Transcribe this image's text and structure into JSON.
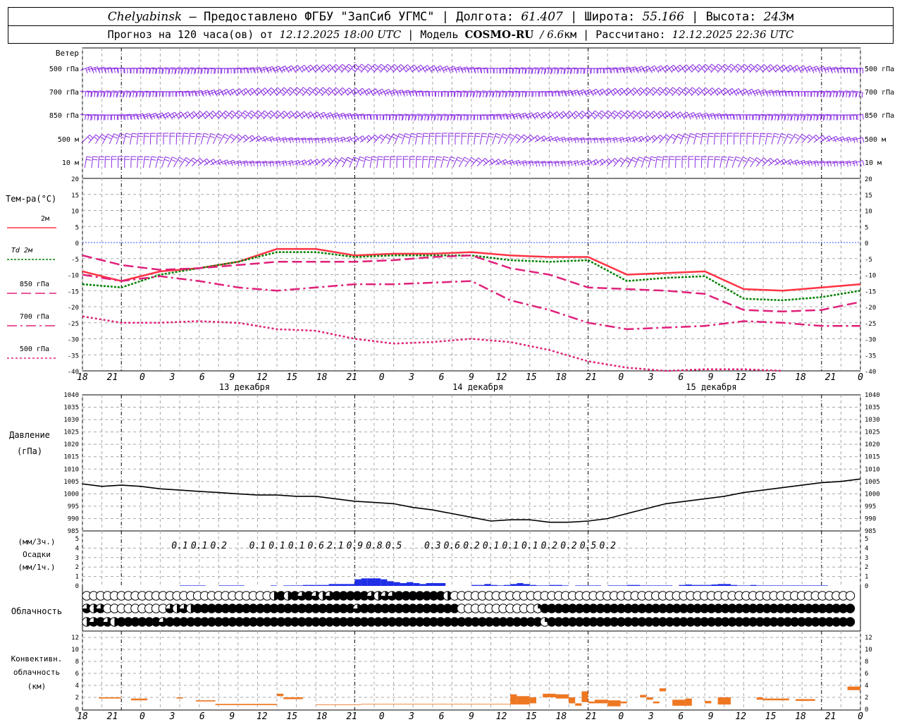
{
  "header": {
    "location": "Chelyabinsk",
    "provider": "— Предоставлено ФГБУ \"ЗапСиб УГМС\"",
    "lon_label": "Долгота:",
    "lon_value": "61.407",
    "lat_label": "Широта:",
    "lat_value": "55.166",
    "alt_label": "Высота:",
    "alt_value": "243",
    "alt_unit": "м",
    "forecast_label": "Прогноз на 120 часа(ов) от",
    "forecast_time": "12.12.2025 18:00 UTC",
    "model_label": "Модель",
    "model_name": "COSMO-RU",
    "model_res": "/ 6.6",
    "model_res_unit": "км",
    "calc_label": "Рассчитано:",
    "calc_time": "12.12.2025 22:36 UTC"
  },
  "colors": {
    "wind": "#8a2be2",
    "t2m": "#ff3344",
    "td2m": "#008000",
    "t850": "#e0207a",
    "t700": "#e0207a",
    "t500": "#e0207a",
    "zero_line": "#3355ff",
    "pressure": "#000000",
    "precip": "#1f2fe6",
    "convective": "#ee7722",
    "grid": "#a8a8a8"
  },
  "wind_panel": {
    "title": "Ветер",
    "levels": [
      "500 гПа",
      "700 гПа",
      "850 гПа",
      "500 м",
      "10  м"
    ]
  },
  "chart_data": [
    {
      "type": "line",
      "title": "Тем-ра(°C)",
      "ylim": [
        -40,
        20
      ],
      "yticks": [
        20,
        15,
        10,
        5,
        0,
        -5,
        -10,
        -15,
        -20,
        -25,
        -30,
        -35,
        -40
      ],
      "x_hours_from_start": [
        0,
        6,
        12,
        18,
        24,
        30,
        36,
        42,
        48,
        54,
        60,
        66,
        72,
        78,
        84,
        90,
        96,
        102,
        108,
        114,
        120
      ],
      "series": [
        {
          "name": "2м",
          "values": [
            -9,
            -12,
            -9,
            -8,
            -6,
            -2,
            -2,
            -4,
            -3.5,
            -3.5,
            -3,
            -4,
            -4.5,
            -4.5,
            -10,
            -9.5,
            -9,
            -14.5,
            -15,
            -14,
            -13
          ]
        },
        {
          "name": "Td 2м",
          "values": [
            -13,
            -14,
            -10,
            -8,
            -6,
            -3,
            -3,
            -4.5,
            -4,
            -4,
            -4,
            -5.5,
            -6,
            -5.5,
            -12,
            -11,
            -10.5,
            -17.5,
            -18,
            -17,
            -15
          ]
        },
        {
          "name": "850 гПа",
          "values": [
            -4,
            -7,
            -8.5,
            -8,
            -7,
            -6,
            -6,
            -6,
            -5.5,
            -4.5,
            -4,
            -8,
            -10,
            -14,
            -14.5,
            -15,
            -16,
            -21,
            -21.5,
            -21,
            -18.5
          ]
        },
        {
          "name": "700 гПа",
          "values": [
            -10,
            -12,
            -10.5,
            -12,
            -14,
            -15,
            -14,
            -13,
            -13,
            -12.5,
            -12,
            -18,
            -21,
            -25,
            -27,
            -26.5,
            -26,
            -24.5,
            -25,
            -26,
            -26
          ]
        },
        {
          "name": "500 гПа",
          "values": [
            -23,
            -25,
            -25,
            -24.5,
            -25,
            -27,
            -27.5,
            -30,
            -31.5,
            -31,
            -30,
            -31,
            -33.5,
            -37,
            -39,
            -40,
            -39.5,
            -39.5,
            -40
          ]
        }
      ],
      "x_ticks": [
        "18",
        "21",
        "0",
        "3",
        "6",
        "9",
        "12",
        "15",
        "18",
        "21",
        "0",
        "3",
        "6",
        "9",
        "12",
        "15",
        "18",
        "21",
        "0",
        "3",
        "6",
        "9",
        "12",
        "15",
        "18",
        "21",
        "0"
      ],
      "day_labels": [
        "13 декабря",
        "14 декабря",
        "15 декабря"
      ]
    },
    {
      "type": "line",
      "title": "Давление",
      "ylabel": "(гПа)",
      "ylim": [
        985,
        1040
      ],
      "yticks": [
        1040,
        1035,
        1030,
        1025,
        1020,
        1015,
        1010,
        1005,
        1000,
        995,
        990,
        985
      ],
      "x_hours_from_start": [
        0,
        3,
        6,
        9,
        12,
        15,
        18,
        21,
        24,
        27,
        30,
        33,
        36,
        39,
        42,
        45,
        48,
        51,
        54,
        57,
        60,
        63,
        66,
        69,
        72,
        75,
        78,
        81,
        84,
        87,
        90,
        93,
        96,
        99,
        102,
        105,
        108,
        111,
        114,
        117,
        120
      ],
      "series": [
        {
          "name": "",
          "values": [
            1004,
            1003,
            1003.5,
            1003,
            1002,
            1001.5,
            1001,
            1000.5,
            1000,
            999.5,
            999.5,
            999,
            999,
            998,
            997,
            996.5,
            996,
            994.5,
            993.5,
            992,
            990.5,
            989,
            989.5,
            989.5,
            988.5,
            988.5,
            989,
            990,
            992,
            994,
            996,
            997,
            998,
            999,
            1000.5,
            1001.5,
            1002.5,
            1003.5,
            1004.5,
            1005,
            1006
          ]
        }
      ]
    },
    {
      "type": "bar",
      "title": "Осадки",
      "ylabel_top": "(мм/3ч.)",
      "ylabel_bottom": "(мм/1ч.)",
      "ylim": [
        0,
        5
      ],
      "yticks": [
        5,
        4,
        3,
        2,
        1,
        0
      ],
      "interval_totals": [
        "0.1",
        "0.1",
        "0.2",
        "0.1",
        "0.1",
        "0.1",
        "0.6",
        "2.1",
        "0.9",
        "0.8",
        "0.5",
        "0.3",
        "0.6",
        "0.2",
        "0.1",
        "0.1",
        "0.1",
        "0.2",
        "0.2",
        "0.5",
        "0.2"
      ],
      "hourly_values": [
        0,
        0,
        0,
        0,
        0,
        0,
        0,
        0,
        0,
        0,
        0,
        0,
        0,
        0,
        0,
        0.05,
        0.05,
        0.05,
        0.05,
        0,
        0,
        0.05,
        0.05,
        0.05,
        0.05,
        0,
        0,
        0,
        0,
        0.05,
        0,
        0.05,
        0.05,
        0.05,
        0.1,
        0.1,
        0.1,
        0.1,
        0.2,
        0.2,
        0.2,
        0.2,
        0.7,
        0.8,
        0.8,
        0.8,
        0.7,
        0.5,
        0.4,
        0.3,
        0.4,
        0.3,
        0.2,
        0.3,
        0.3,
        0.3,
        0,
        0,
        0,
        0,
        0.1,
        0.1,
        0.2,
        0.1,
        0.05,
        0.1,
        0.2,
        0.3,
        0.2,
        0.1,
        0.05,
        0.05,
        0.1,
        0.1,
        0.05,
        0,
        0.05,
        0.05,
        0.05,
        0.05,
        0,
        0.05,
        0.05,
        0.05,
        0.1,
        0.1,
        0.05,
        0.05,
        0.05,
        0.05,
        0.05,
        0,
        0.1,
        0.15,
        0.1,
        0.1,
        0.1,
        0.15,
        0.2,
        0.2,
        0.1,
        0.05,
        0.05,
        0.1,
        0.05,
        0.05,
        0.05,
        0.05,
        0.05,
        0.05,
        0.05,
        0.05,
        0.05,
        0.05,
        0.05
      ]
    },
    {
      "type": "table",
      "title": "Облачность",
      "rows": 3,
      "note": "cloud cover fraction per hour, rows: high/medium/low",
      "values": [
        [
          0,
          0,
          0,
          0,
          0,
          0,
          0,
          0,
          0,
          0,
          0,
          0,
          0,
          0,
          0,
          0,
          0,
          0,
          0,
          0,
          0,
          0,
          0,
          0,
          0,
          0,
          0,
          0.5,
          1,
          0.5,
          1,
          0.75,
          1,
          0.75,
          0.5,
          0.75,
          1,
          1,
          1,
          1,
          1,
          0.75,
          0.5,
          0.75,
          0.75,
          1,
          1,
          1,
          1,
          1,
          1,
          1,
          0.5,
          0,
          0,
          0,
          0,
          0,
          0,
          0,
          0,
          0,
          0,
          0,
          0,
          0,
          0,
          0,
          0,
          0,
          0,
          0,
          0,
          0,
          0,
          0,
          0,
          0,
          0,
          0,
          0,
          0,
          0,
          0,
          0,
          0,
          0,
          0,
          0,
          0,
          0,
          0,
          0,
          0,
          0,
          0,
          0,
          0,
          0,
          0,
          0,
          0,
          0,
          0,
          0,
          0,
          0,
          0,
          0,
          0,
          0
        ],
        [
          0.75,
          0.5,
          0.75,
          0,
          0,
          0,
          0,
          0,
          0,
          0,
          0,
          0,
          0.75,
          0.5,
          0.75,
          0.5,
          1,
          1,
          1,
          1,
          1,
          1,
          1,
          1,
          1,
          1,
          1,
          1,
          1,
          1,
          1,
          1,
          1,
          1,
          1,
          1,
          1,
          1,
          1,
          0.75,
          1,
          1,
          1,
          1,
          1,
          1,
          1,
          1,
          1,
          1,
          1,
          1,
          1,
          1,
          0,
          0,
          0,
          0,
          0,
          0,
          0,
          0,
          0,
          0,
          0,
          0.25,
          1,
          1,
          1,
          1,
          1,
          1,
          1,
          1,
          1,
          1,
          1,
          1,
          1,
          1,
          1,
          1,
          1,
          1,
          1,
          1,
          1,
          1,
          1,
          1,
          1,
          1,
          1,
          1,
          1,
          1,
          1,
          1,
          1,
          1,
          1,
          1,
          1,
          1,
          1,
          1,
          1,
          1,
          1,
          1,
          1
        ],
        [
          0.5,
          0.75,
          1,
          0.75,
          0.5,
          1,
          1,
          1,
          1,
          1,
          1,
          0.75,
          1,
          1,
          1,
          1,
          1,
          1,
          1,
          1,
          1,
          1,
          1,
          1,
          1,
          1,
          1,
          1,
          1,
          1,
          1,
          1,
          1,
          1,
          1,
          1,
          1,
          1,
          1,
          1,
          1,
          1,
          1,
          1,
          1,
          1,
          1,
          1,
          1,
          1,
          1,
          1,
          1,
          1,
          1,
          1,
          1,
          1,
          1,
          1,
          1,
          1,
          1,
          1,
          1,
          1,
          0.25,
          1,
          1,
          1,
          1,
          1,
          1,
          1,
          1,
          1,
          1,
          1,
          1,
          1,
          1,
          1,
          1,
          1,
          1,
          1,
          1,
          1,
          1,
          1,
          1,
          1,
          1,
          1,
          1,
          1,
          1,
          1,
          1,
          1,
          1,
          1,
          1,
          1,
          1,
          1,
          1,
          1,
          1,
          1,
          1
        ]
      ]
    },
    {
      "type": "bar",
      "title": "Конвективн.",
      "title2": "облачность",
      "ylabel": "(км)",
      "ylim": [
        0,
        13
      ],
      "yticks": [
        12,
        10,
        8,
        6,
        4,
        2,
        0
      ],
      "segments": [
        {
          "h0": 2.5,
          "h1": 6,
          "base": 1.8,
          "top": 2.0
        },
        {
          "h0": 7.5,
          "h1": 10,
          "base": 1.5,
          "top": 1.8
        },
        {
          "h0": 14.5,
          "h1": 15.5,
          "base": 1.8,
          "top": 2.0
        },
        {
          "h0": 17.5,
          "h1": 20.5,
          "base": 1.3,
          "top": 1.5
        },
        {
          "h0": 20.5,
          "h1": 30,
          "base": 0.7,
          "top": 0.9
        },
        {
          "h0": 30,
          "h1": 31,
          "base": 2.2,
          "top": 2.6
        },
        {
          "h0": 31,
          "h1": 34,
          "base": 1.7,
          "top": 2.0
        },
        {
          "h0": 36,
          "h1": 43,
          "base": 0.7,
          "top": 0.8
        },
        {
          "h0": 43,
          "h1": 66,
          "base": 0.8,
          "top": 0.9
        },
        {
          "h0": 66,
          "h1": 67,
          "base": 0.8,
          "top": 2.5
        },
        {
          "h0": 67,
          "h1": 69,
          "base": 0.8,
          "top": 2.2
        },
        {
          "h0": 69,
          "h1": 70,
          "base": 1.0,
          "top": 2.0
        },
        {
          "h0": 71,
          "h1": 73,
          "base": 2.0,
          "top": 2.6
        },
        {
          "h0": 73,
          "h1": 75,
          "base": 1.8,
          "top": 2.5
        },
        {
          "h0": 75,
          "h1": 76,
          "base": 1.0,
          "top": 2.0
        },
        {
          "h0": 76,
          "h1": 77,
          "base": 0.6,
          "top": 1.0
        },
        {
          "h0": 77,
          "h1": 78,
          "base": 1.2,
          "top": 3.0
        },
        {
          "h0": 78,
          "h1": 79,
          "base": 1.0,
          "top": 1.3
        },
        {
          "h0": 79,
          "h1": 81,
          "base": 1.0,
          "top": 1.6
        },
        {
          "h0": 81,
          "h1": 83,
          "base": 0.5,
          "top": 1.5
        },
        {
          "h0": 83,
          "h1": 84,
          "base": 1.0,
          "top": 1.3
        },
        {
          "h0": 86,
          "h1": 87,
          "base": 2.0,
          "top": 2.4
        },
        {
          "h0": 87,
          "h1": 88,
          "base": 1.6,
          "top": 2.0
        },
        {
          "h0": 88,
          "h1": 89,
          "base": 1.0,
          "top": 1.3
        },
        {
          "h0": 89,
          "h1": 90,
          "base": 3.0,
          "top": 3.5
        },
        {
          "h0": 91,
          "h1": 93,
          "base": 0.6,
          "top": 1.6
        },
        {
          "h0": 93,
          "h1": 94,
          "base": 0.6,
          "top": 1.8
        },
        {
          "h0": 96,
          "h1": 97,
          "base": 1.0,
          "top": 1.4
        },
        {
          "h0": 98,
          "h1": 100,
          "base": 0.8,
          "top": 2.0
        },
        {
          "h0": 104,
          "h1": 105,
          "base": 1.6,
          "top": 2.0
        },
        {
          "h0": 105,
          "h1": 109,
          "base": 1.5,
          "top": 1.8
        },
        {
          "h0": 110,
          "h1": 112,
          "base": 1.4,
          "top": 1.7
        },
        {
          "h0": 112,
          "h1": 113,
          "base": 1.4,
          "top": 1.7
        },
        {
          "h0": 118,
          "h1": 120,
          "base": 3.2,
          "top": 3.8
        }
      ]
    }
  ]
}
